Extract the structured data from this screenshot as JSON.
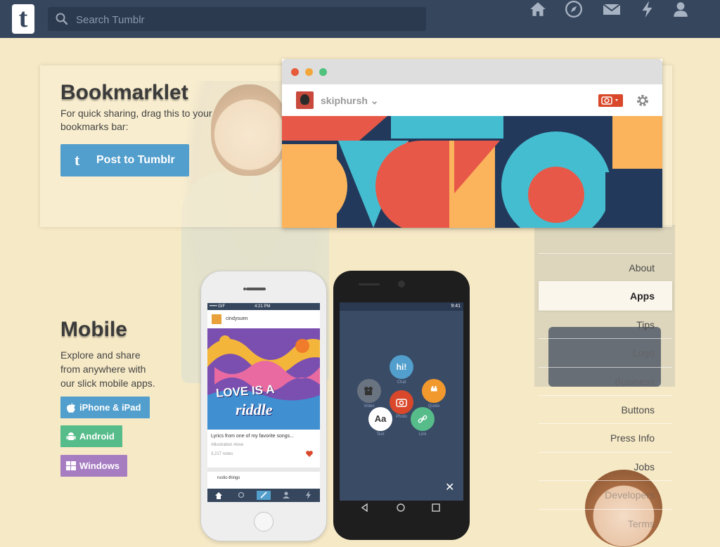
{
  "header": {
    "logo_letter": "t",
    "search_placeholder": "Search Tumblr",
    "icons": [
      "home-icon",
      "explore-icon",
      "mail-icon",
      "activity-icon",
      "account-icon"
    ],
    "bg_color": "#36465d"
  },
  "bookmarklet": {
    "title": "Bookmarklet",
    "description_line1": "For quick sharing, drag this to your",
    "description_line2": "bookmarks bar:",
    "button_label": "Post to Tumblr",
    "button_icon_letter": "t",
    "button_color": "#529ecc"
  },
  "browser_mock": {
    "username": "skiphursh",
    "dropdown_glyph": "⌄"
  },
  "mobile": {
    "title": "Mobile",
    "description": [
      "Explore and share",
      "from anywhere with",
      "our slick mobile apps."
    ],
    "buttons": [
      {
        "label": "iPhone & iPad",
        "color": "#529ecc",
        "icon": "apple-icon"
      },
      {
        "label": "Android",
        "color": "#56bc8a",
        "icon": "android-icon"
      },
      {
        "label": "Windows",
        "color": "#a77dc2",
        "icon": "windows-icon"
      }
    ]
  },
  "iphone_screen": {
    "status_time": "4:21 PM",
    "status_carrier": "••••• GIF",
    "poster": "cindysuen",
    "art_text_1": "LOVE IS A",
    "art_text_2": "riddle",
    "caption": "Lyrics from one of my favorite songs...",
    "tags": "#illustration #love",
    "notes": "3,217 notes",
    "next_poster": "rustic-things"
  },
  "android_screen": {
    "status_time": "9:41",
    "post_types": [
      {
        "glyph": "hi!",
        "label": "Chat",
        "color": "#529ecc"
      },
      {
        "glyph": "🎥",
        "label": "Video",
        "color": "#6a7380"
      },
      {
        "glyph": "📷",
        "label": "Photo",
        "color": "#d9482b"
      },
      {
        "glyph": "❝",
        "label": "Quote",
        "color": "#f2992e"
      },
      {
        "glyph": "Aa",
        "label": "Text",
        "color": "#ffffff"
      },
      {
        "glyph": "🔗",
        "label": "Link",
        "color": "#56bc8a"
      }
    ],
    "close_glyph": "✕"
  },
  "sidenav": {
    "items": [
      {
        "label": "About",
        "state": "normal"
      },
      {
        "label": "Apps",
        "state": "active"
      },
      {
        "label": "Tips",
        "state": "normal"
      },
      {
        "label": "Logo",
        "state": "faint"
      },
      {
        "label": "Business",
        "state": "faint"
      },
      {
        "label": "Buttons",
        "state": "normal"
      },
      {
        "label": "Press Info",
        "state": "normal"
      },
      {
        "label": "Jobs",
        "state": "normal"
      },
      {
        "label": "Developers",
        "state": "faint"
      },
      {
        "label": "Terms",
        "state": "faint"
      }
    ]
  }
}
